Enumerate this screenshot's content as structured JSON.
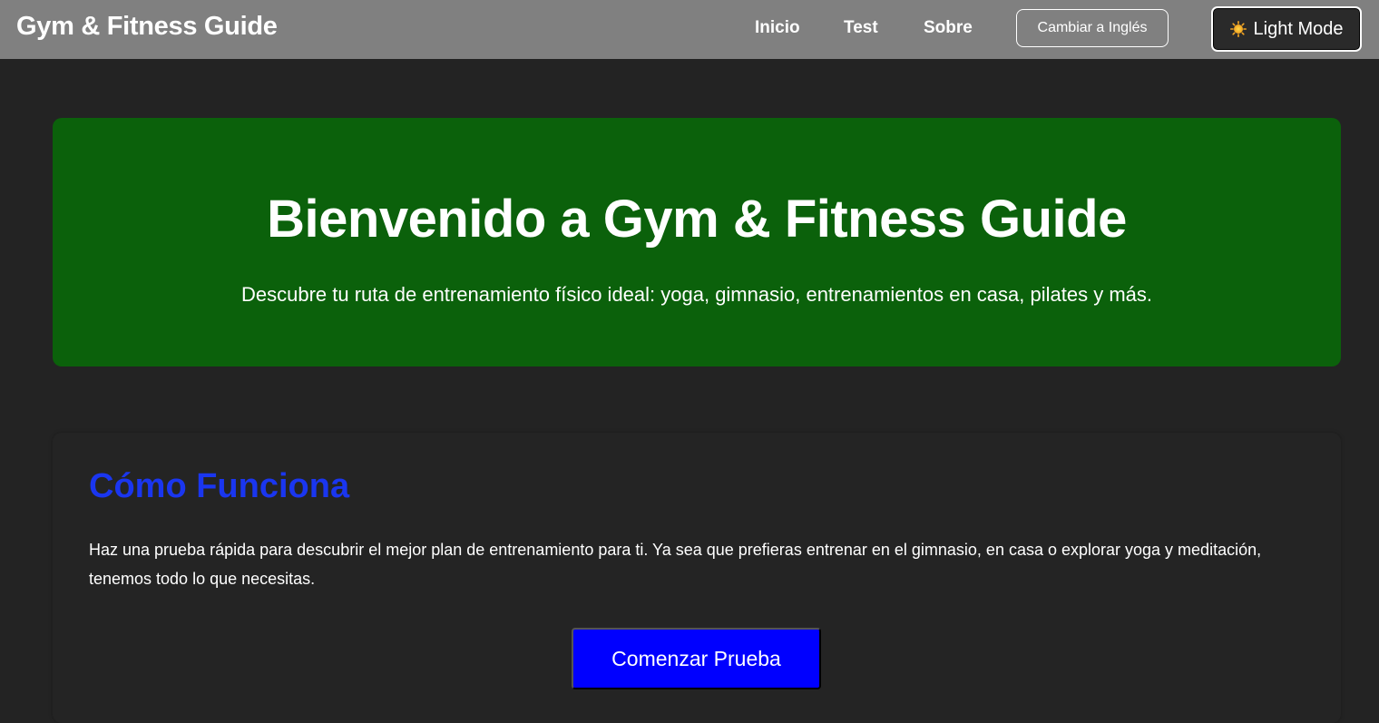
{
  "header": {
    "brand": "Gym & Fitness Guide",
    "nav": {
      "inicio": "Inicio",
      "test": "Test",
      "sobre": "Sobre"
    },
    "language_button": "Cambiar a Inglés",
    "mode_button": "Light Mode",
    "mode_icon": "sun-icon"
  },
  "hero": {
    "title": "Bienvenido a Gym & Fitness Guide",
    "subtitle": "Descubre tu ruta de entrenamiento físico ideal: yoga, gimnasio, entrenamientos en casa, pilates y más."
  },
  "how_it_works": {
    "title": "Cómo Funciona",
    "body": "Haz una prueba rápida para descubrir el mejor plan de entrenamiento para ti. Ya sea que prefieras entrenar en el gimnasio, en casa o explorar yoga y meditación, tenemos todo lo que necesitas.",
    "start_button": "Comenzar Prueba"
  },
  "colors": {
    "header_bg": "#808080",
    "page_bg": "#232323",
    "hero_bg": "#0b610b",
    "section_title": "#1a36f0",
    "primary_button": "#0000ff"
  }
}
